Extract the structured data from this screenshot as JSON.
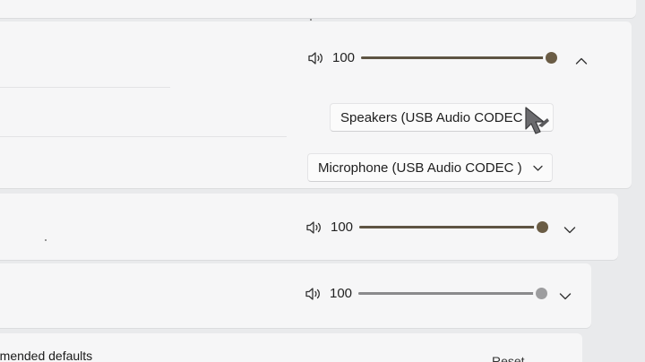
{
  "master_volume": {
    "value": "100",
    "level": 1.0,
    "expanded": true,
    "icon": "speaker-icon"
  },
  "output_device": {
    "selected": "Speakers (USB Audio CODEC )"
  },
  "input_device": {
    "selected": "Microphone (USB Audio CODEC )"
  },
  "app_volumes": [
    {
      "value": "100",
      "level": 1.0,
      "icon": "speaker-icon"
    },
    {
      "value": "100",
      "level": 1.0,
      "icon": "speaker-icon"
    }
  ],
  "reset_section": {
    "label": "mmended defaults",
    "button": "Reset"
  },
  "colors": {
    "slider_fill": "#5e5443",
    "slider_thumb": "#6a5c45",
    "card_bg": "#f6f6f7",
    "page_bg": "#e9eaec"
  }
}
